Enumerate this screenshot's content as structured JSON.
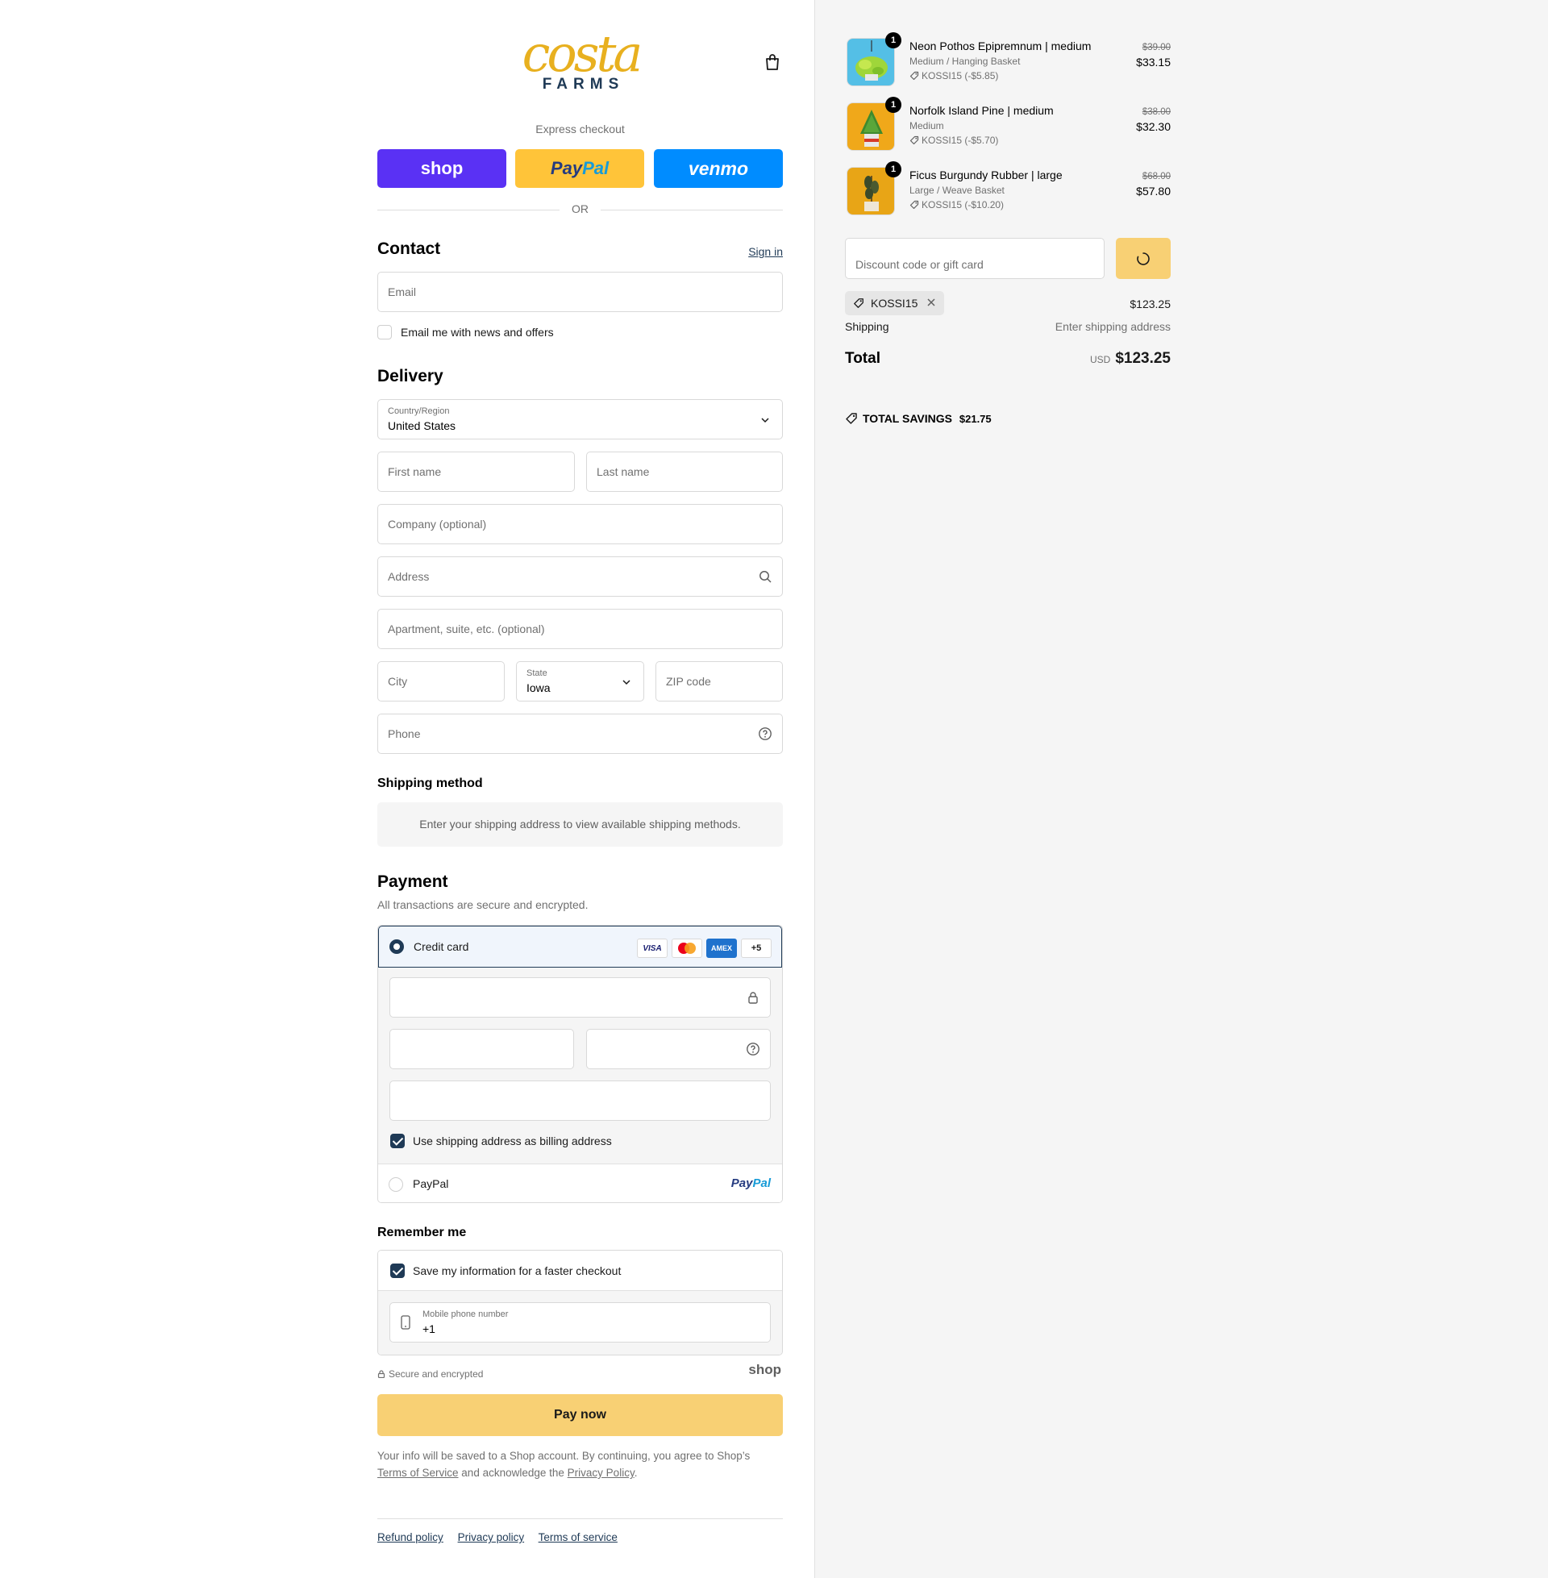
{
  "brand": {
    "logo_top": "costa",
    "logo_bottom": "FARMS"
  },
  "express": {
    "label": "Express checkout",
    "shop": "shop",
    "paypal_pay": "Pay",
    "paypal_pal": "Pal",
    "venmo": "venmo",
    "or": "OR"
  },
  "contact": {
    "title": "Contact",
    "sign_in": "Sign in",
    "email_placeholder": "Email",
    "news_label": "Email me with news and offers"
  },
  "delivery": {
    "title": "Delivery",
    "country_label": "Country/Region",
    "country_value": "United States",
    "first_name": "First name",
    "last_name": "Last name",
    "company": "Company (optional)",
    "address": "Address",
    "apartment": "Apartment, suite, etc. (optional)",
    "city": "City",
    "state_label": "State",
    "state_value": "Iowa",
    "zip": "ZIP code",
    "phone": "Phone"
  },
  "shipping": {
    "title": "Shipping method",
    "message": "Enter your shipping address to view available shipping methods."
  },
  "payment": {
    "title": "Payment",
    "subtitle": "All transactions are secure and encrypted.",
    "credit_card": "Credit card",
    "card_visa": "VISA",
    "card_amex": "AMEX",
    "card_more": "+5",
    "billing_label": "Use shipping address as billing address",
    "paypal_label": "PayPal",
    "paypal_logo_pay": "Pay",
    "paypal_logo_pal": "Pal"
  },
  "remember": {
    "title": "Remember me",
    "save_label": "Save my information for a faster checkout",
    "mobile_label": "Mobile phone number",
    "mobile_value": "+1",
    "secure": "Secure and encrypted",
    "shop_logo": "shop"
  },
  "pay_now": "Pay now",
  "consent": {
    "text1": "Your info will be saved to a Shop account. By continuing, you agree to Shop’s",
    "terms": "Terms of Service",
    "text2": "and acknowledge the",
    "privacy": "Privacy Policy",
    "text3": "."
  },
  "footer": {
    "refund": "Refund policy",
    "privacy": "Privacy policy",
    "terms": "Terms of service"
  },
  "summary": {
    "items": [
      {
        "name": "Neon Pothos Epipremnum | medium",
        "variant": "Medium / Hanging Basket",
        "discount": "KOSSI15 (-$5.85)",
        "old_price": "$39.00",
        "price": "$33.15",
        "qty": "1"
      },
      {
        "name": "Norfolk Island Pine | medium",
        "variant": "Medium",
        "discount": "KOSSI15 (-$5.70)",
        "old_price": "$38.00",
        "price": "$32.30",
        "qty": "1"
      },
      {
        "name": "Ficus Burgundy Rubber | large",
        "variant": "Large / Weave Basket",
        "discount": "KOSSI15 (-$10.20)",
        "old_price": "$68.00",
        "price": "$57.80",
        "qty": "1"
      }
    ],
    "discount_placeholder": "Discount code or gift card",
    "applied_code": "KOSSI15",
    "subtotal": "$123.25",
    "shipping_label": "Shipping",
    "shipping_value": "Enter shipping address",
    "total_label": "Total",
    "currency": "USD",
    "total": "$123.25",
    "savings_label": "TOTAL SAVINGS",
    "savings_value": "$21.75"
  },
  "colors": {
    "accent": "#1f3a56",
    "pay_button": "#f8d074",
    "shop": "#5a31f4",
    "paypal": "#ffc439",
    "venmo": "#008cff"
  }
}
